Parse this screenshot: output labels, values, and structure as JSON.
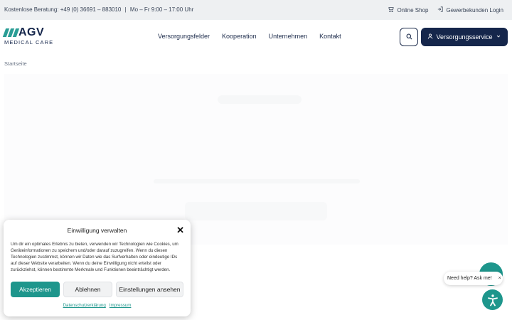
{
  "topbar": {
    "hotline_label": "Kostenlose Beratung:",
    "phone": "+49 (0) 36691 – 883010",
    "separator": "|",
    "hours": "Mo – Fr 9:00 – 17:00 Uhr",
    "shop_label": "Online Shop",
    "login_label": "Gewerbekunden Login"
  },
  "brand": {
    "logo_text": "AGV",
    "logo_subtext": "MEDICAL CARE"
  },
  "nav": {
    "items": [
      "Versorgungsfelder",
      "Kooperation",
      "Unternehmen",
      "Kontakt"
    ],
    "service_button": "Versorgungsservice"
  },
  "breadcrumb": "Startseite",
  "consent": {
    "title": "Einwilligung verwalten",
    "body": "Um dir ein optimales Erlebnis zu bieten, verwenden wir Technologien wie Cookies, um Geräteinformationen zu speichern und/oder darauf zuzugreifen. Wenn du diesen Technologien zustimmst, können wir Daten wie das Surfverhalten oder eindeutige IDs auf dieser Website verarbeiten. Wenn du deine Einwilligung nicht erteilst oder zurückziehst, können bestimmte Merkmale und Funktionen beeinträchtigt werden.",
    "accept": "Akzeptieren",
    "deny": "Ablehnen",
    "preferences": "Einstellungen ansehen",
    "privacy_link": "Datenschutzerklärung",
    "imprint_link": "Impressum"
  },
  "chat": {
    "prompt": "Need help? Ask me!",
    "close": "×"
  },
  "colors": {
    "navy": "#15264b",
    "teal": "#1e968c",
    "topbar_bg": "#eef0f2"
  },
  "icons": [
    "shop-icon",
    "login-icon",
    "search-icon",
    "user-icon",
    "chevron-down-icon",
    "close-icon",
    "chat-icon",
    "accessibility-icon"
  ]
}
